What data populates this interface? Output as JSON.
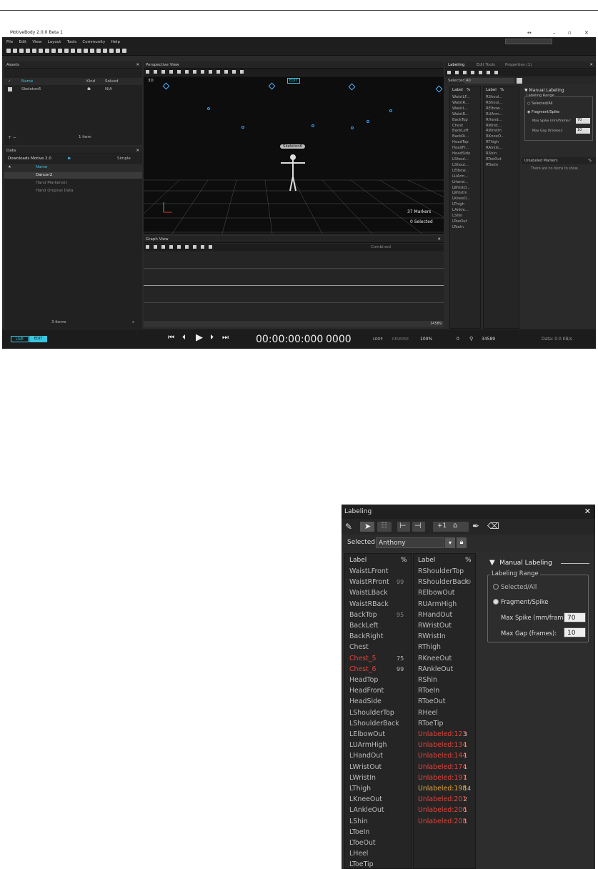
{
  "app": {
    "title": "MotiveBody 2.0.0 Beta 1",
    "menu": [
      "File",
      "Edit",
      "View",
      "Layout",
      "Tools",
      "Community",
      "Help"
    ]
  },
  "assets": {
    "title": "Assets",
    "columns": [
      "Name",
      "Kind",
      "Solved"
    ],
    "rows": [
      {
        "name": "Skeleton6",
        "solved": "N/A"
      }
    ],
    "footer": "1 item"
  },
  "data_panel": {
    "title": "Data",
    "path": "Downloads  Motive 2.0",
    "mode": "Simple",
    "column": "Name",
    "rows": [
      "Dancer2",
      "Hand Markerset",
      "Hand Original Data"
    ],
    "footer": "3 items"
  },
  "perspective": {
    "title": "Perspective View",
    "mode_label": "3D",
    "edit_badge": "EDIT",
    "skeleton_label": "Skeleton6",
    "markers": "37 Markers",
    "selected": "0 Selected"
  },
  "graph": {
    "title": "Graph View",
    "combined": "Combined",
    "frame_end": "34589"
  },
  "right_tabs": [
    "Labeling",
    "Edit Tools",
    "Properties (1)"
  ],
  "labeling_small": {
    "selected_label": "Selected",
    "selected_value": "All",
    "manual": "Manual Labeling",
    "range": "Labeling Range",
    "opt1": "Selected/All",
    "opt2": "Fragment/Spike",
    "spike_label": "Max Spike (mm/frame):",
    "spike_value": "70",
    "gap_label": "Max Gap (frames):",
    "gap_value": "10",
    "unlabeled_title": "Unlabeled Markers",
    "unlabeled_pct": "%",
    "empty_msg": "There are no items to show.",
    "col1": [
      "WaistLF...",
      "WaistR...",
      "WaistL...",
      "WaistR...",
      "BackTop",
      "Chest",
      "BackLeft",
      "BackRi...",
      "HeadTop",
      "HeadFr...",
      "HeadSide",
      "LShoul...",
      "LShoul...",
      "LElbow...",
      "LUArm...",
      "LHand...",
      "LWristO...",
      "LWristIn",
      "LKneeO...",
      "LThigh",
      "LAnkle...",
      "LShin",
      "LToeOut",
      "LToeIn"
    ],
    "col2": [
      "RShoul...",
      "RShoul...",
      "RElbow...",
      "RUArm...",
      "RHand...",
      "RWrist...",
      "RWristIn",
      "RKneeO...",
      "RThigh",
      "RAnkle...",
      "RShin",
      "RToeOut",
      "RToeIn"
    ]
  },
  "transport": {
    "live": "LIVE",
    "edit": "EDIT",
    "timecode": "00:00:00:000",
    "frame": "0000",
    "loop": "LOOP",
    "reverse": "REVERSE",
    "speed": "100%",
    "start": "0",
    "end": "34589",
    "data_rate": "Data: 0.0 KB/s"
  },
  "labeling_zoom": {
    "title": "Labeling",
    "selected_label": "Selected",
    "selected_value": "Anthony",
    "plus_one": "+1",
    "col_label": "Label",
    "col_pct": "%",
    "col1": [
      {
        "t": "WaistLFront",
        "p": "",
        "c": ""
      },
      {
        "t": "WaistRFront",
        "p": "99",
        "c": ""
      },
      {
        "t": "WaistLBack",
        "p": "",
        "c": ""
      },
      {
        "t": "WaistRBack",
        "p": "",
        "c": ""
      },
      {
        "t": "BackTop",
        "p": "95",
        "c": ""
      },
      {
        "t": "BackLeft",
        "p": "",
        "c": ""
      },
      {
        "t": "BackRight",
        "p": "",
        "c": ""
      },
      {
        "t": "Chest",
        "p": "",
        "c": ""
      },
      {
        "t": "Chest_5",
        "p": "75",
        "c": "red"
      },
      {
        "t": "Chest_6",
        "p": "99",
        "c": "red"
      },
      {
        "t": "HeadTop",
        "p": "",
        "c": ""
      },
      {
        "t": "HeadFront",
        "p": "",
        "c": ""
      },
      {
        "t": "HeadSide",
        "p": "",
        "c": ""
      },
      {
        "t": "LShoulderTop",
        "p": "",
        "c": ""
      },
      {
        "t": "LShoulderBack",
        "p": "",
        "c": ""
      },
      {
        "t": "LElbowOut",
        "p": "",
        "c": ""
      },
      {
        "t": "LUArmHigh",
        "p": "",
        "c": ""
      },
      {
        "t": "LHandOut",
        "p": "",
        "c": ""
      },
      {
        "t": "LWristOut",
        "p": "",
        "c": ""
      },
      {
        "t": "LWristIn",
        "p": "",
        "c": ""
      },
      {
        "t": "LThigh",
        "p": "",
        "c": ""
      },
      {
        "t": "LKneeOut",
        "p": "",
        "c": ""
      },
      {
        "t": "LAnkleOut",
        "p": "",
        "c": ""
      },
      {
        "t": "LShin",
        "p": "",
        "c": ""
      },
      {
        "t": "LToeIn",
        "p": "",
        "c": ""
      },
      {
        "t": "LToeOut",
        "p": "",
        "c": ""
      },
      {
        "t": "LHeel",
        "p": "",
        "c": ""
      },
      {
        "t": "LToeTip",
        "p": "",
        "c": ""
      }
    ],
    "col2": [
      {
        "t": "RShoulderTop",
        "p": "",
        "c": ""
      },
      {
        "t": "RShoulderBack",
        "p": "99",
        "c": ""
      },
      {
        "t": "RElbowOut",
        "p": "",
        "c": ""
      },
      {
        "t": "RUArmHigh",
        "p": "",
        "c": ""
      },
      {
        "t": "RHandOut",
        "p": "",
        "c": ""
      },
      {
        "t": "RWristOut",
        "p": "",
        "c": ""
      },
      {
        "t": "RWristIn",
        "p": "",
        "c": ""
      },
      {
        "t": "RThigh",
        "p": "",
        "c": ""
      },
      {
        "t": "RKneeOut",
        "p": "",
        "c": ""
      },
      {
        "t": "RAnkleOut",
        "p": "",
        "c": ""
      },
      {
        "t": "RShin",
        "p": "",
        "c": ""
      },
      {
        "t": "RToeIn",
        "p": "",
        "c": ""
      },
      {
        "t": "RToeOut",
        "p": "",
        "c": ""
      },
      {
        "t": "RHeel",
        "p": "",
        "c": ""
      },
      {
        "t": "RToeTip",
        "p": "",
        "c": ""
      },
      {
        "t": "Unlabeled:123",
        "p": "3",
        "c": "red"
      },
      {
        "t": "Unlabeled:134",
        "p": "1",
        "c": "red"
      },
      {
        "t": "Unlabeled:144",
        "p": "1",
        "c": "red"
      },
      {
        "t": "Unlabeled:174",
        "p": "1",
        "c": "red"
      },
      {
        "t": "Unlabeled:197",
        "p": "1",
        "c": "red"
      },
      {
        "t": "Unlabeled:198",
        "p": "14",
        "c": "amber"
      },
      {
        "t": "Unlabeled:201",
        "p": "2",
        "c": "red"
      },
      {
        "t": "Unlabeled:206",
        "p": "1",
        "c": "red"
      },
      {
        "t": "Unlabeled:208",
        "p": "1",
        "c": "red"
      }
    ],
    "manual": "Manual Labeling",
    "range": "Labeling Range",
    "opt1": "Selected/All",
    "opt2": "Fragment/Spike",
    "spike_label": "Max Spike (mm/frame):",
    "spike_value": "70",
    "gap_label": "Max Gap (frames):",
    "gap_value": "10"
  },
  "colors": {
    "accent": "#39c4e0",
    "unlabeled": "#e0433c",
    "warning": "#e4a43a",
    "panel": "#2d2d2d"
  }
}
